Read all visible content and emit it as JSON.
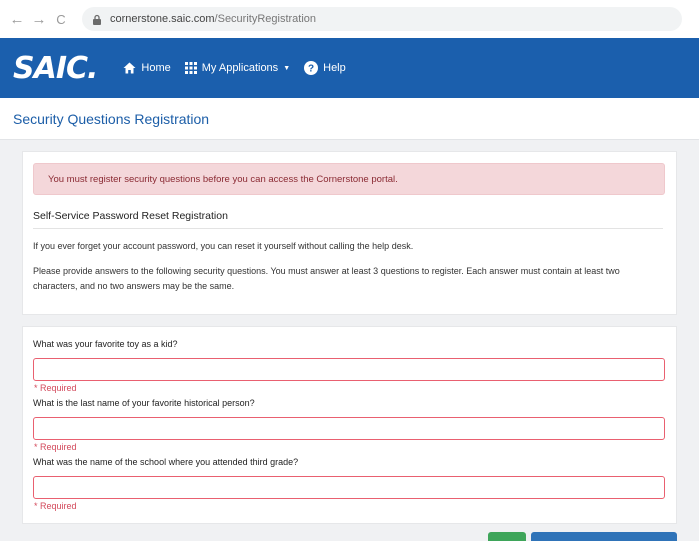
{
  "browser": {
    "back_icon": "←",
    "forward_icon": "→",
    "reload_icon": "C",
    "url_host": "cornerstone.saic.com",
    "url_path": "/SecurityRegistration"
  },
  "nav": {
    "logo": "SAIC.",
    "home": "Home",
    "my_applications": "My Applications",
    "help": "Help"
  },
  "page": {
    "title": "Security Questions Registration"
  },
  "notice": {
    "alert": "You must register security questions before you can access the Cornerstone portal.",
    "heading": "Self-Service Password Reset Registration",
    "para1": "If you ever forget your account password, you can reset it yourself without calling the help desk.",
    "para2": "Please provide answers to the following security questions. You must answer at least 3 questions to register. Each answer must contain at least two characters, and no two answers may be the same."
  },
  "questions": [
    {
      "label": "What was your favorite toy as a kid?",
      "value": "",
      "required": "* Required"
    },
    {
      "label": "What is the last name of your favorite historical person?",
      "value": "",
      "required": "* Required"
    },
    {
      "label": "What was the name of the school where you attended third grade?",
      "value": "",
      "required": "* Required"
    }
  ],
  "colors": {
    "nav_bg": "#1b5fad",
    "title": "#1c5ea8",
    "alert_bg": "#f4d7da",
    "error": "#e96070",
    "green_button": "#3ea55a",
    "blue_button": "#2f73b8"
  }
}
